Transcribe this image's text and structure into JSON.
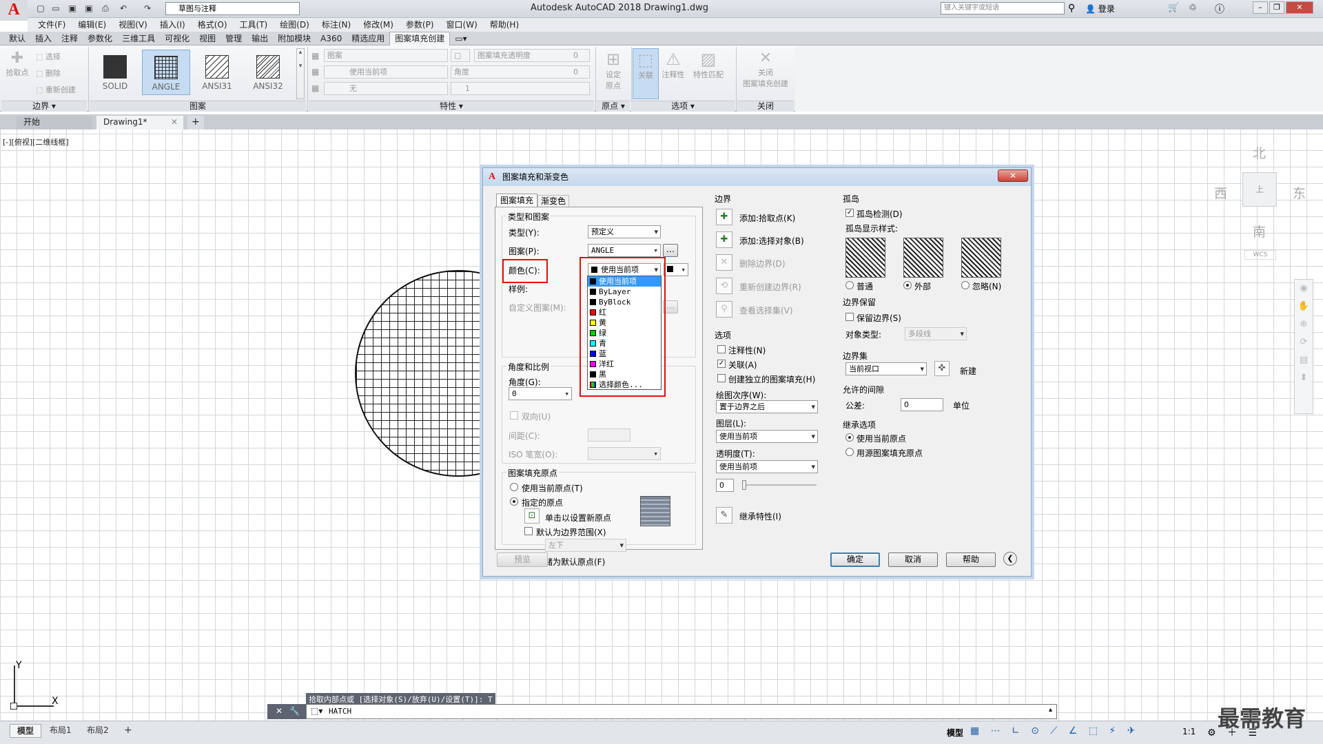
{
  "app": {
    "title": "Autodesk AutoCAD 2018    Drawing1.dwg",
    "workspace": "草图与注释",
    "search_placeholder": "键入关键字或短语",
    "login": "登录"
  },
  "menus": [
    "文件(F)",
    "编辑(E)",
    "视图(V)",
    "插入(I)",
    "格式(O)",
    "工具(T)",
    "绘图(D)",
    "标注(N)",
    "修改(M)",
    "参数(P)",
    "窗口(W)",
    "帮助(H)"
  ],
  "ribbon_tabs": [
    "默认",
    "插入",
    "注释",
    "参数化",
    "三维工具",
    "可视化",
    "视图",
    "管理",
    "输出",
    "附加模块",
    "A360",
    "精选应用",
    "图案填充创建"
  ],
  "ribbon": {
    "boundary": {
      "pick": "拾取点",
      "select": "选择",
      "remove": "删除",
      "recreate": "重新创建",
      "title": "边界"
    },
    "patterns": [
      {
        "name": "SOLID"
      },
      {
        "name": "ANGLE"
      },
      {
        "name": "ANSI31"
      },
      {
        "name": "ANSI32"
      }
    ],
    "pattern_title": "图案",
    "props": {
      "type": "图案",
      "transparency": "图案填充透明度",
      "transparency_val": "0",
      "color": "使用当前项",
      "angle": "角度",
      "angle_val": "0",
      "bg": "无",
      "scale": "1",
      "title": "特性"
    },
    "origin": {
      "label1": "设定",
      "label2": "原点",
      "title": "原点"
    },
    "options": {
      "assoc": "关联",
      "annot": "注释性",
      "match": "特性匹配",
      "title": "选项"
    },
    "close": {
      "label1": "关闭",
      "label2": "图案填充创建",
      "title": "关闭"
    }
  },
  "doc_tabs": {
    "start": "开始",
    "drawing": "Drawing1*"
  },
  "viewport_label": "[-][俯视][二维线框]",
  "compass": {
    "north": "北",
    "south": "南",
    "east": "东",
    "west": "西",
    "wcs": "WCS"
  },
  "dialog": {
    "title": "图案填充和渐变色",
    "tabs": [
      "图案填充",
      "渐变色"
    ],
    "type_pattern": {
      "legend": "类型和图案",
      "type_label": "类型(Y):",
      "type_val": "预定义",
      "pattern_label": "图案(P):",
      "pattern_val": "ANGLE",
      "color_label": "颜色(C):",
      "color_val": "使用当前项",
      "sample_label": "样例:",
      "custom_label": "自定义图案(M):"
    },
    "color_options": [
      {
        "label": "使用当前项",
        "color": "#000000"
      },
      {
        "label": "ByLayer",
        "color": "#000000"
      },
      {
        "label": "ByBlock",
        "color": "#000000"
      },
      {
        "label": "红",
        "color": "#ff0000"
      },
      {
        "label": "黄",
        "color": "#ffff00"
      },
      {
        "label": "绿",
        "color": "#00cc00"
      },
      {
        "label": "青",
        "color": "#00ffff"
      },
      {
        "label": "蓝",
        "color": "#0000ff"
      },
      {
        "label": "洋红",
        "color": "#ff00ff"
      },
      {
        "label": "黑",
        "color": "#000000"
      },
      {
        "label": "选择颜色...",
        "color": "#4060a0"
      }
    ],
    "angle_scale": {
      "legend": "角度和比例",
      "angle_label": "角度(G):",
      "angle_val": "0",
      "double_label": "双向(U)",
      "spacing_label": "间距(C):",
      "iso_label": "ISO 笔宽(O):"
    },
    "origin": {
      "legend": "图案填充原点",
      "use_current": "使用当前原点(T)",
      "specified": "指定的原点",
      "click_set": "单击以设置新原点",
      "default_extent": "默认为边界范围(X)",
      "position": "左下",
      "store_default": "存储为默认原点(F)"
    },
    "preview": "预览",
    "boundary": {
      "legend": "边界",
      "add_pick": "添加:拾取点(K)",
      "add_select": "添加:选择对象(B)",
      "remove": "删除边界(D)",
      "recreate": "重新创建边界(R)",
      "view_sel": "查看选择集(V)"
    },
    "options": {
      "legend": "选项",
      "annotative": "注释性(N)",
      "associative": "关联(A)",
      "separate": "创建独立的图案填充(H)",
      "draw_order_label": "绘图次序(W):",
      "draw_order_val": "置于边界之后",
      "layer_label": "图层(L):",
      "layer_val": "使用当前项",
      "transp_label": "透明度(T):",
      "transp_val": "使用当前项",
      "transp_num": "0",
      "inherit": "继承特性(I)"
    },
    "islands": {
      "legend": "孤岛",
      "detect": "孤岛检测(D)",
      "style_label": "孤岛显示样式:",
      "normal": "普通",
      "outer": "外部",
      "ignore": "忽略(N)"
    },
    "retain": {
      "legend": "边界保留",
      "keep": "保留边界(S)",
      "obj_type_label": "对象类型:",
      "obj_type_val": "多段线"
    },
    "boundary_set": {
      "legend": "边界集",
      "val": "当前视口",
      "new": "新建"
    },
    "gap": {
      "legend": "允许的间隙",
      "tol_label": "公差:",
      "tol_val": "0",
      "unit": "单位"
    },
    "inherit_opts": {
      "legend": "继承选项",
      "use_current": "使用当前原点",
      "use_source": "用源图案填充原点"
    },
    "buttons": {
      "ok": "确定",
      "cancel": "取消",
      "help": "帮助"
    }
  },
  "command": {
    "hint": "拾取内部点或 [选择对象(S)/放弃(U)/设置(T)]: T",
    "text": "HATCH"
  },
  "layout_tabs": [
    "模型",
    "布局1",
    "布局2"
  ],
  "status": {
    "model": "模型",
    "scale": "1:1"
  },
  "watermark": "最需教育"
}
